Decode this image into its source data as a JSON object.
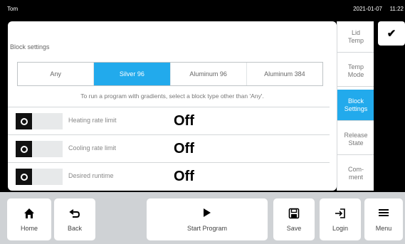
{
  "topbar": {
    "user": "Tom",
    "date": "2021-01-07",
    "time": "11:22"
  },
  "panel": {
    "title": "Block settings",
    "block_types": [
      "Any",
      "Silver 96",
      "Aluminum 96",
      "Aluminum 384"
    ],
    "selected_block_type": "Silver 96",
    "hint": "To run a program with gradients, select a block type other than 'Any'.",
    "rows": [
      {
        "label": "Heating rate limit",
        "value": "Off"
      },
      {
        "label": "Cooling rate limit",
        "value": "Off"
      },
      {
        "label": "Desired runtime",
        "value": "Off"
      }
    ]
  },
  "side_tabs": [
    {
      "label": "Lid\nTemp"
    },
    {
      "label": "Temp\nMode"
    },
    {
      "label": "Block\nSettings",
      "active": true
    },
    {
      "label": "Release\nState"
    },
    {
      "label": "Com-\nment"
    }
  ],
  "confirm_icon": "checkmark-icon",
  "footer": {
    "home": {
      "label": "Home",
      "icon": "home-icon"
    },
    "back": {
      "label": "Back",
      "icon": "back-arrow-icon"
    },
    "start": {
      "label": "Start Program",
      "icon": "play-icon"
    },
    "save": {
      "label": "Save",
      "icon": "floppy-disk-icon"
    },
    "login": {
      "label": "Login",
      "icon": "login-icon"
    },
    "menu": {
      "label": "Menu",
      "icon": "menu-icon"
    }
  },
  "colors": {
    "accent": "#22aaec",
    "background": "#000000",
    "footer": "#cfd2d5"
  }
}
